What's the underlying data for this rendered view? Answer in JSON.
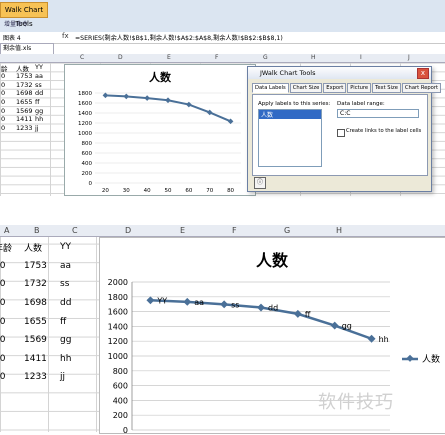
{
  "ribbon": {
    "tab_label": "Walk Chart Tools",
    "sub_label": "增量命令"
  },
  "formula_bar": {
    "name_box": "图表 4",
    "fx": "fx",
    "formula": "=SERIES(剩余人数!$B$1,剩余人数!$A$2:$A$8,剩余人数!$B$2:$B$8,1)"
  },
  "file_tab": {
    "label": "剩余值.xls"
  },
  "columns_top": [
    "C",
    "D",
    "E",
    "F",
    "G",
    "H",
    "I",
    "J"
  ],
  "columns_bottom": [
    "A",
    "B",
    "C",
    "D",
    "E",
    "F",
    "G",
    "H"
  ],
  "table": {
    "headers": [
      "年龄",
      "人数",
      "YY"
    ],
    "rows": [
      [
        "20",
        "1753",
        "aa"
      ],
      [
        "30",
        "1732",
        "ss"
      ],
      [
        "40",
        "1698",
        "dd"
      ],
      [
        "50",
        "1655",
        "ff"
      ],
      [
        "60",
        "1569",
        "gg"
      ],
      [
        "70",
        "1411",
        "hh"
      ],
      [
        "80",
        "1233",
        "jj"
      ]
    ],
    "top_headers": [
      "龄",
      "人数",
      "YY"
    ],
    "top_rows": [
      [
        "0",
        "1753",
        "aa"
      ],
      [
        "0",
        "1732",
        "ss"
      ],
      [
        "0",
        "1698",
        "dd"
      ],
      [
        "0",
        "1655",
        "ff"
      ],
      [
        "0",
        "1569",
        "gg"
      ],
      [
        "0",
        "1411",
        "hh"
      ],
      [
        "0",
        "1233",
        "jj"
      ]
    ]
  },
  "chart_data": [
    {
      "type": "line",
      "title": "人数",
      "x": [
        20,
        30,
        40,
        50,
        60,
        70,
        80
      ],
      "series": [
        {
          "name": "人数",
          "values": [
            1753,
            1732,
            1698,
            1655,
            1569,
            1411,
            1233
          ]
        }
      ],
      "yticks": [
        "1800",
        "1600",
        "1400",
        "1200",
        "1000",
        "800",
        "600",
        "400",
        "200",
        "0"
      ],
      "xticks": [
        "20",
        "30",
        "40",
        "50",
        "60",
        "70",
        "80"
      ],
      "ylim": [
        0,
        1800
      ],
      "color": "#4a7098"
    },
    {
      "type": "line",
      "title": "人数",
      "x": [
        20,
        30,
        40,
        50,
        60,
        70,
        80
      ],
      "series": [
        {
          "name": "人数",
          "values": [
            1753,
            1732,
            1698,
            1655,
            1569,
            1411,
            1233
          ]
        }
      ],
      "data_labels": [
        "YY",
        "aa",
        "ss",
        "dd",
        "ff",
        "gg",
        "hh"
      ],
      "yticks": [
        "2000",
        "1800",
        "1600",
        "1400",
        "1200",
        "1000",
        "800",
        "600",
        "400",
        "200",
        "0"
      ],
      "ylim": [
        0,
        2000
      ],
      "legend": "人数",
      "legend_position": "right",
      "color": "#4a7098"
    }
  ],
  "dialog": {
    "title": "JWalk Chart Tools",
    "close": "x",
    "tabs": [
      "Data Labels",
      "Chart Size",
      "Export",
      "Picture",
      "Text Size",
      "Chart Report"
    ],
    "apply_label": "Apply labels to this series:",
    "series_item": "人数",
    "range_label": "Data label range:",
    "range_value": "C:C",
    "checkbox_label": "Create links to the label cells",
    "corner_icon": "info-icon"
  },
  "watermark": {
    "text": "软件技巧"
  }
}
